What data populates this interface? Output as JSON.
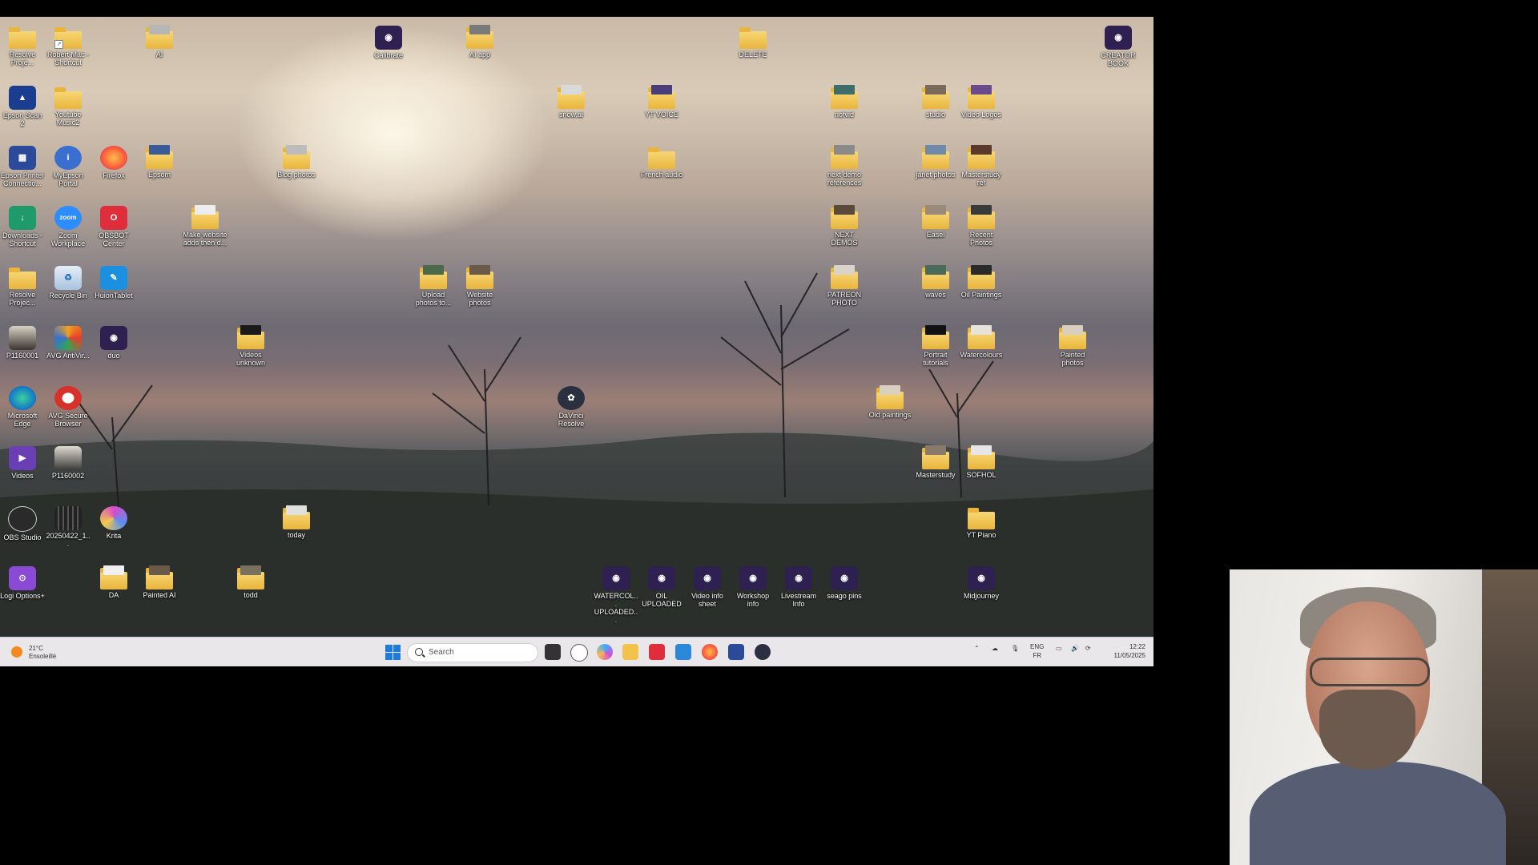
{
  "desktop": {
    "icons": [
      {
        "label": "Resolve Proje...",
        "kind": "folder"
      },
      {
        "label": "Robert Mac - Shortcut",
        "kind": "folder"
      },
      {
        "label": "AI",
        "kind": "folder"
      },
      {
        "label": "Calibrate",
        "kind": "app"
      },
      {
        "label": "AI app",
        "kind": "folder"
      },
      {
        "label": "DELETE",
        "kind": "folder"
      },
      {
        "label": "CREATOR BOOK",
        "kind": "app"
      },
      {
        "label": "Epson Scan 2",
        "kind": "app"
      },
      {
        "label": "Youtube Music2",
        "kind": "folder"
      },
      {
        "label": "snow.ai",
        "kind": "folder"
      },
      {
        "label": "YT VOICE",
        "kind": "folder"
      },
      {
        "label": "nofvid",
        "kind": "folder"
      },
      {
        "label": "studio",
        "kind": "folder"
      },
      {
        "label": "Video Logos",
        "kind": "folder"
      },
      {
        "label": "Epson Printer Connectio...",
        "kind": "app"
      },
      {
        "label": "MyEpson Portal",
        "kind": "app"
      },
      {
        "label": "Firefox",
        "kind": "app"
      },
      {
        "label": "Epsom",
        "kind": "folder"
      },
      {
        "label": "Blog photos",
        "kind": "folder"
      },
      {
        "label": "French audio",
        "kind": "folder"
      },
      {
        "label": "next demo references",
        "kind": "folder"
      },
      {
        "label": "janet photos",
        "kind": "folder"
      },
      {
        "label": "Masterstudy ref",
        "kind": "folder"
      },
      {
        "label": "Downloads - Shortcut",
        "kind": "app"
      },
      {
        "label": "Zoom Workplace",
        "kind": "app"
      },
      {
        "label": "OBSBOT Center",
        "kind": "app"
      },
      {
        "label": "Make website adds then d...",
        "kind": "folder"
      },
      {
        "label": "NEXT DEMOS",
        "kind": "folder"
      },
      {
        "label": "Easel",
        "kind": "folder"
      },
      {
        "label": "Recent Photos",
        "kind": "folder"
      },
      {
        "label": "Resolve Projec...",
        "kind": "folder"
      },
      {
        "label": "Recycle Bin",
        "kind": "app"
      },
      {
        "label": "HuionTablet",
        "kind": "app"
      },
      {
        "label": "Upload photos to...",
        "kind": "folder"
      },
      {
        "label": "Website photos",
        "kind": "folder"
      },
      {
        "label": "PATREON PHOTO",
        "kind": "folder"
      },
      {
        "label": "waves",
        "kind": "folder"
      },
      {
        "label": "Oil Paintings",
        "kind": "folder"
      },
      {
        "label": "P1160001",
        "kind": "image"
      },
      {
        "label": "AVG AntiVir...",
        "kind": "app"
      },
      {
        "label": "duo",
        "kind": "app"
      },
      {
        "label": "Videos unknown",
        "kind": "folder"
      },
      {
        "label": "Portrait tutorials",
        "kind": "folder"
      },
      {
        "label": "Watercolours",
        "kind": "folder"
      },
      {
        "label": "Painted photos",
        "kind": "folder"
      },
      {
        "label": "Microsoft Edge",
        "kind": "app"
      },
      {
        "label": "AVG Secure Browser",
        "kind": "app"
      },
      {
        "label": "DaVinci Resolve",
        "kind": "app"
      },
      {
        "label": "Old paintings",
        "kind": "folder"
      },
      {
        "label": "Videos",
        "kind": "app"
      },
      {
        "label": "P1160002",
        "kind": "image"
      },
      {
        "label": "Masterstudy",
        "kind": "folder"
      },
      {
        "label": "SOFHOL",
        "kind": "folder"
      },
      {
        "label": "OBS Studio",
        "kind": "app"
      },
      {
        "label": "20250422_1...",
        "kind": "image"
      },
      {
        "label": "Krita",
        "kind": "app"
      },
      {
        "label": "today",
        "kind": "folder"
      },
      {
        "label": "YT Piano",
        "kind": "folder"
      },
      {
        "label": "Logi Options+",
        "kind": "app"
      },
      {
        "label": "DA",
        "kind": "folder"
      },
      {
        "label": "Painted AI",
        "kind": "folder"
      },
      {
        "label": "todd",
        "kind": "folder"
      },
      {
        "label": "WATERCOL... UPLOADED...",
        "kind": "app"
      },
      {
        "label": "OIL UPLOADED",
        "kind": "app"
      },
      {
        "label": "Video info sheet",
        "kind": "app"
      },
      {
        "label": "Workshop info",
        "kind": "app"
      },
      {
        "label": "Livestream Info",
        "kind": "app"
      },
      {
        "label": "seago pins",
        "kind": "app"
      },
      {
        "label": "Midjourney",
        "kind": "app"
      }
    ]
  },
  "taskbar": {
    "weather_temp": "21°C",
    "weather_desc": "Ensoleillé",
    "search_placeholder": "Search",
    "lang_1": "ENG",
    "lang_2": "FR",
    "time": "12:22",
    "date": "11/05/2025",
    "pinned": [
      "task-view-icon",
      "dell-icon",
      "copilot-icon",
      "file-explorer-icon",
      "obsbot-icon",
      "notepad-icon",
      "firefox-icon",
      "epson-icon",
      "davinci-icon"
    ]
  },
  "colors": {
    "taskbar_bg": "#e9e7ea",
    "folder": "#f3c94f",
    "accent": "#1f7ae0"
  }
}
